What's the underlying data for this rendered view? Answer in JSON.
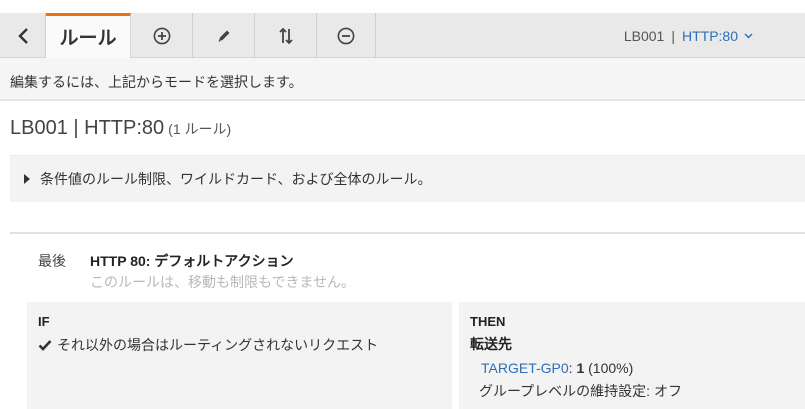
{
  "toolbar": {
    "back_icon": "chevron-left-icon",
    "active_tab": "ルール",
    "add_icon": "plus-circle-icon",
    "edit_icon": "pencil-icon",
    "reorder_icon": "sort-arrows-icon",
    "delete_icon": "minus-circle-icon",
    "load_balancer": "LB001",
    "separator": "|",
    "listener": "HTTP:80",
    "accent_color": "#ec7211",
    "link_color": "#2e6fb5"
  },
  "hint": "編集するには、上記からモードを選択します。",
  "header": {
    "title": "LB001 | HTTP:80",
    "rule_count": "(1 ルール)"
  },
  "expander": {
    "label": "条件値のルール制限、ワイルドカード、および全体のルール。"
  },
  "rule": {
    "order": "最後",
    "name": "HTTP 80: デフォルトアクション",
    "note": "このルールは、移動も制限もできません。",
    "if": {
      "heading": "IF",
      "condition": "それ以外の場合はルーティングされないリクエスト"
    },
    "then": {
      "heading": "THEN",
      "action": "転送先",
      "target_group": "TARGET-GP0",
      "target_sep": ": ",
      "weight": "1",
      "percent": " (100%)",
      "stickiness": "グループレベルの維持設定: オフ"
    }
  }
}
